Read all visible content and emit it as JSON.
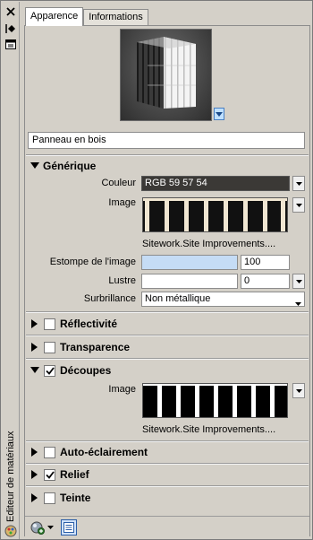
{
  "sidebar": {
    "title": "Editeur de matériaux"
  },
  "tabs": [
    {
      "label": "Apparence",
      "active": true
    },
    {
      "label": "Informations",
      "active": false
    }
  ],
  "material_name": "Panneau en bois",
  "sections": {
    "generic": {
      "title": "Générique",
      "expanded": true,
      "color_label": "Couleur",
      "color_value": "RGB 59 57 54",
      "image_label": "Image",
      "image_caption": "Sitework.Site Improvements....",
      "fade_label": "Estompe de l'image",
      "fade_value": "100",
      "gloss_label": "Lustre",
      "gloss_value": "0",
      "highlight_label": "Surbrillance",
      "highlight_value": "Non métallique"
    },
    "reflectivity": {
      "title": "Réflectivité",
      "checked": false
    },
    "transparency": {
      "title": "Transparence",
      "checked": false
    },
    "cutouts": {
      "title": "Découpes",
      "checked": true,
      "image_label": "Image",
      "image_caption": "Sitework.Site Improvements...."
    },
    "self_illum": {
      "title": "Auto-éclairement",
      "checked": false
    },
    "relief": {
      "title": "Relief",
      "checked": true
    },
    "tint": {
      "title": "Teinte",
      "checked": false
    }
  },
  "colors": {
    "color_swatch": "#3b3936",
    "fade_bar": "#c5dcf5"
  }
}
